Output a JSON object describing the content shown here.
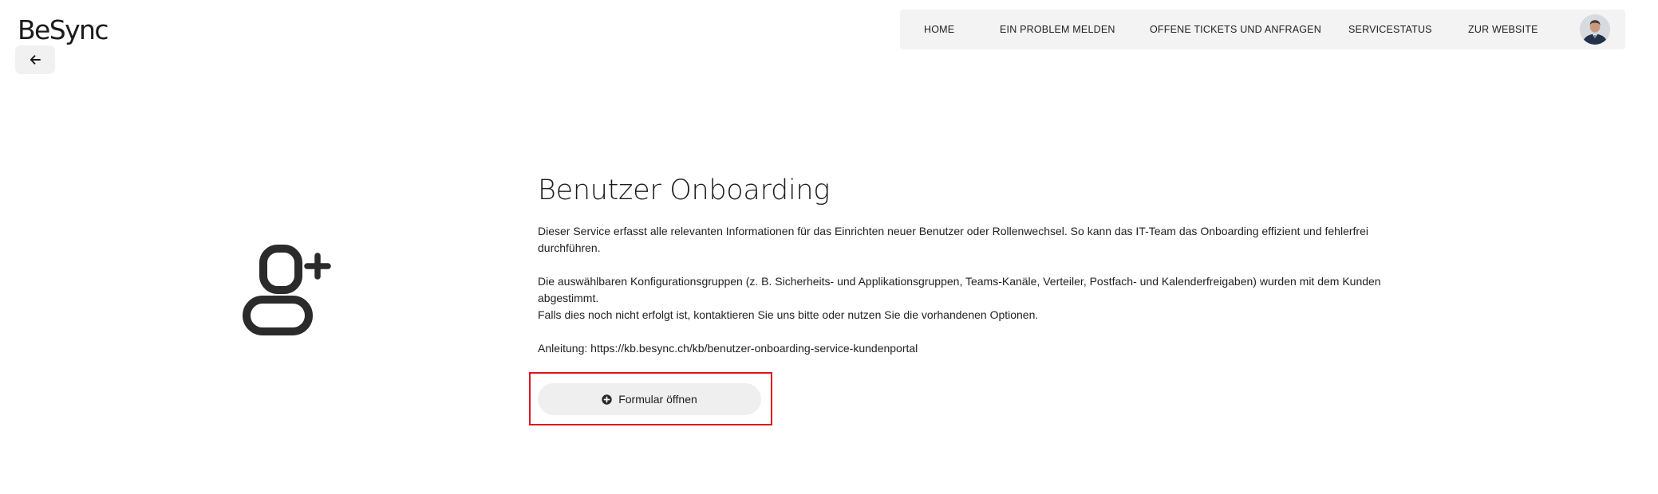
{
  "header": {
    "logo_text": "BeSync",
    "back_icon": "arrow-left-icon"
  },
  "nav": {
    "items": [
      {
        "label": "HOME"
      },
      {
        "label": "EIN PROBLEM MELDEN"
      },
      {
        "label": "OFFENE TICKETS UND ANFRAGEN"
      },
      {
        "label": "SERVICESTATUS"
      },
      {
        "label": "ZUR WEBSITE"
      }
    ],
    "avatar_icon": "user-avatar"
  },
  "service": {
    "icon": "user-add-icon",
    "title": "Benutzer Onboarding",
    "paragraph_1": "Dieser Service erfasst alle relevanten Informationen für das Einrichten neuer Benutzer oder Rollenwechsel. So kann das IT-Team das Onboarding effizient und fehlerfrei durchführen.",
    "paragraph_2": "Die auswählbaren Konfigurationsgruppen (z. B. Sicherheits- und Applikationsgruppen, Teams-Kanäle, Verteiler, Postfach- und Kalenderfreigaben) wurden mit dem Kunden abgestimmt.",
    "paragraph_3": "Falls dies noch nicht erfolgt ist, kontaktieren Sie uns bitte oder nutzen Sie die vorhandenen Optionen.",
    "paragraph_4": "Anleitung: https://kb.besync.ch/kb/benutzer-onboarding-service-kundenportal",
    "button_label": "Formular öffnen",
    "button_icon": "plus-circle-icon"
  },
  "colors": {
    "highlight": "#e0141e",
    "nav_background": "#f3f3f3",
    "button_background": "#efefef"
  }
}
